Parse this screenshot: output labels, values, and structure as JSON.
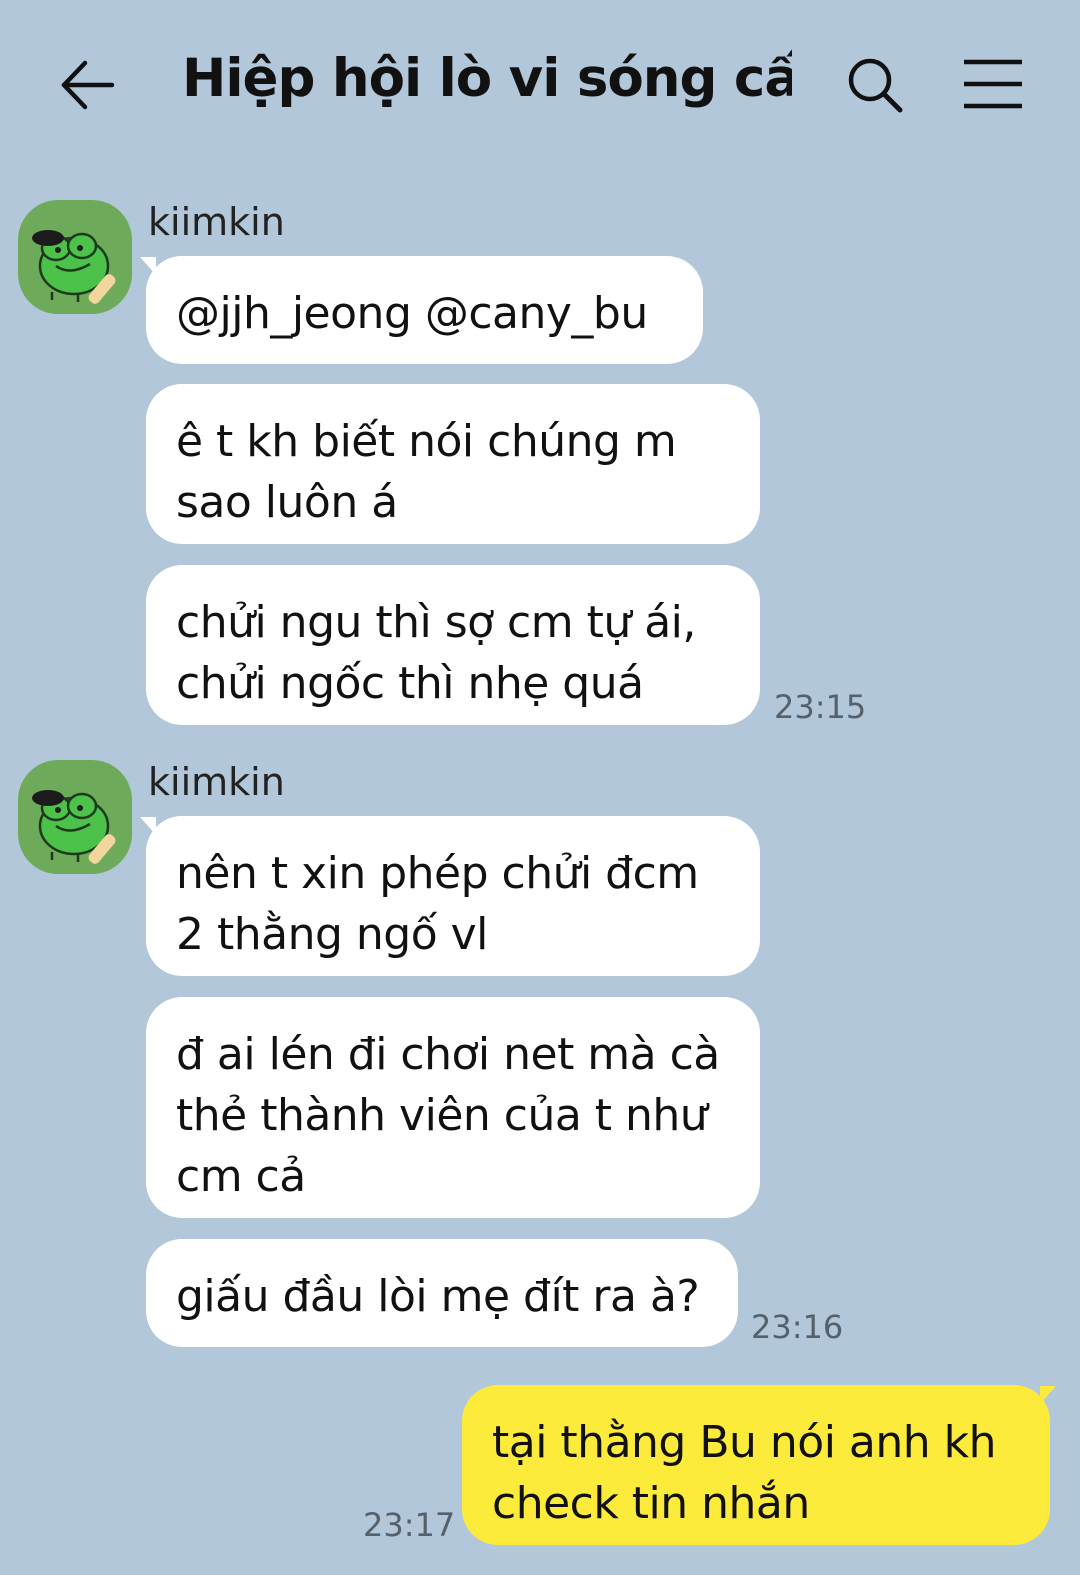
{
  "header": {
    "title": "Hiệp hội lò vi sóng cấ...",
    "back_icon": "arrow-left-icon",
    "search_icon": "search-icon",
    "menu_icon": "menu-icon"
  },
  "groups": [
    {
      "sender": "kiimkin",
      "messages": [
        "@jjh_jeong @cany_bu",
        "ê t kh biết nói chúng m\nsao luôn á",
        "chửi ngu thì sợ cm tự ái,\nchửi ngốc thì nhẹ quá"
      ],
      "time": "23:15"
    },
    {
      "sender": "kiimkin",
      "messages": [
        "nên t xin phép chửi đcm\n2 thằng ngố vl",
        "đ ai lén đi chơi net mà cà\nthẻ thành viên của t như\ncm cả",
        "giấu đầu lòi mẹ đít ra à?"
      ],
      "time": "23:16"
    }
  ],
  "own_message": {
    "text": "tại thằng Bu nói anh kh\ncheck tin nhắn",
    "time": "23:17"
  },
  "colors": {
    "background": "#b2c7da",
    "bubble_other": "#ffffff",
    "bubble_own": "#fdeb3c",
    "avatar": "#6dab5a"
  }
}
